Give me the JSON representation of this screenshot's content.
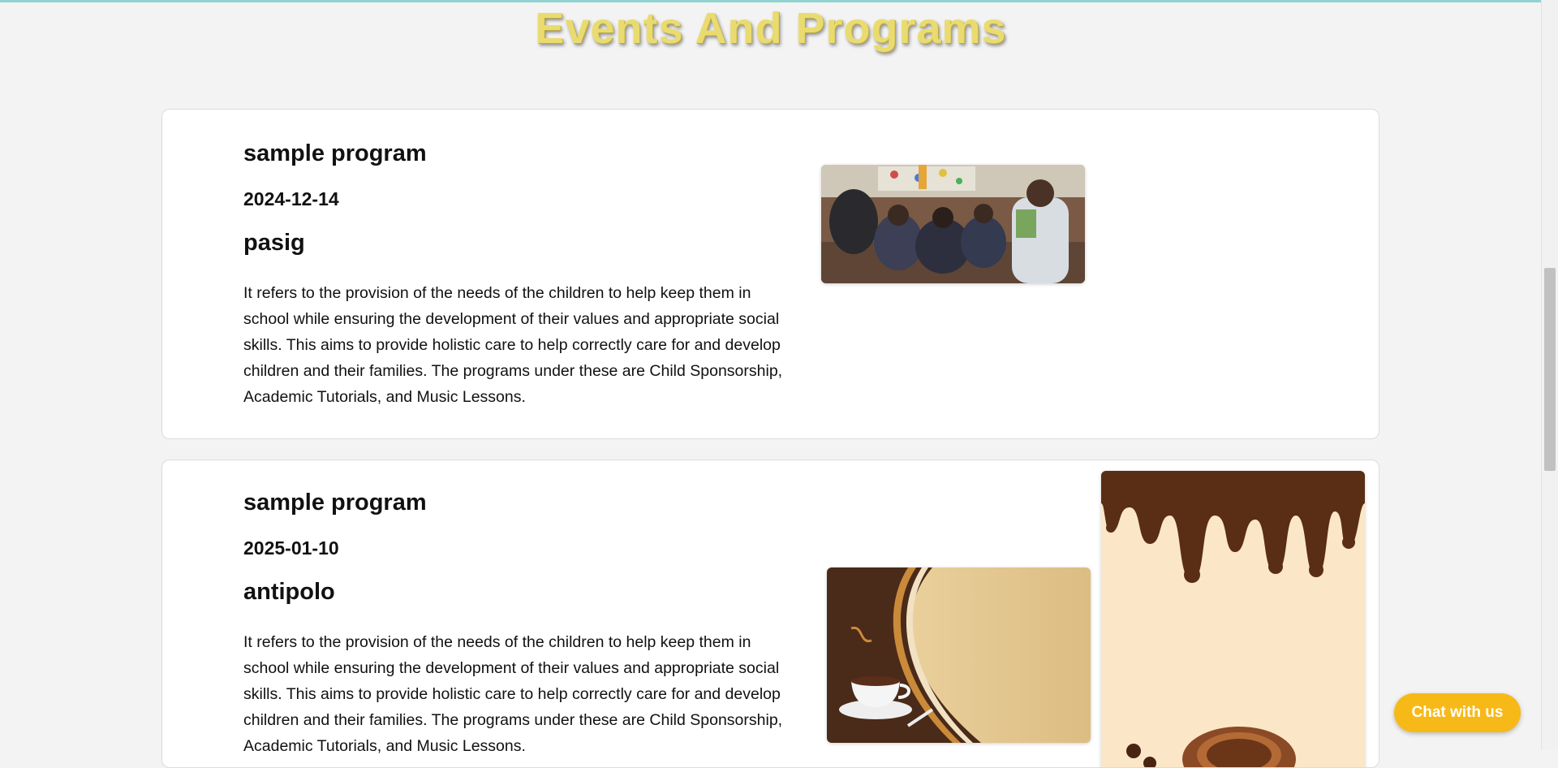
{
  "page": {
    "title": "Events And Programs"
  },
  "events": [
    {
      "title": "sample program",
      "date": "2024-12-14",
      "location": "pasig",
      "description": "It refers to the provision of the needs of the children to help keep them in school while ensuring the development of their values and appropriate social skills. This aims to provide holistic care to help correctly care for and develop children and their families. The programs under these are Child Sponsorship, Academic Tutorials, and Music Lessons."
    },
    {
      "title": "sample program",
      "date": "2025-01-10",
      "location": "antipolo",
      "description": "It refers to the provision of the needs of the children to help keep them in school while ensuring the development of their values and appropriate social skills. This aims to provide holistic care to help correctly care for and develop children and their families. The programs under these are Child Sponsorship, Academic Tutorials, and Music Lessons."
    }
  ],
  "chat": {
    "label": "Chat with us"
  },
  "colors": {
    "title": "#eadb6f",
    "chat_button": "#f7b917",
    "background": "#f3f3f3"
  }
}
